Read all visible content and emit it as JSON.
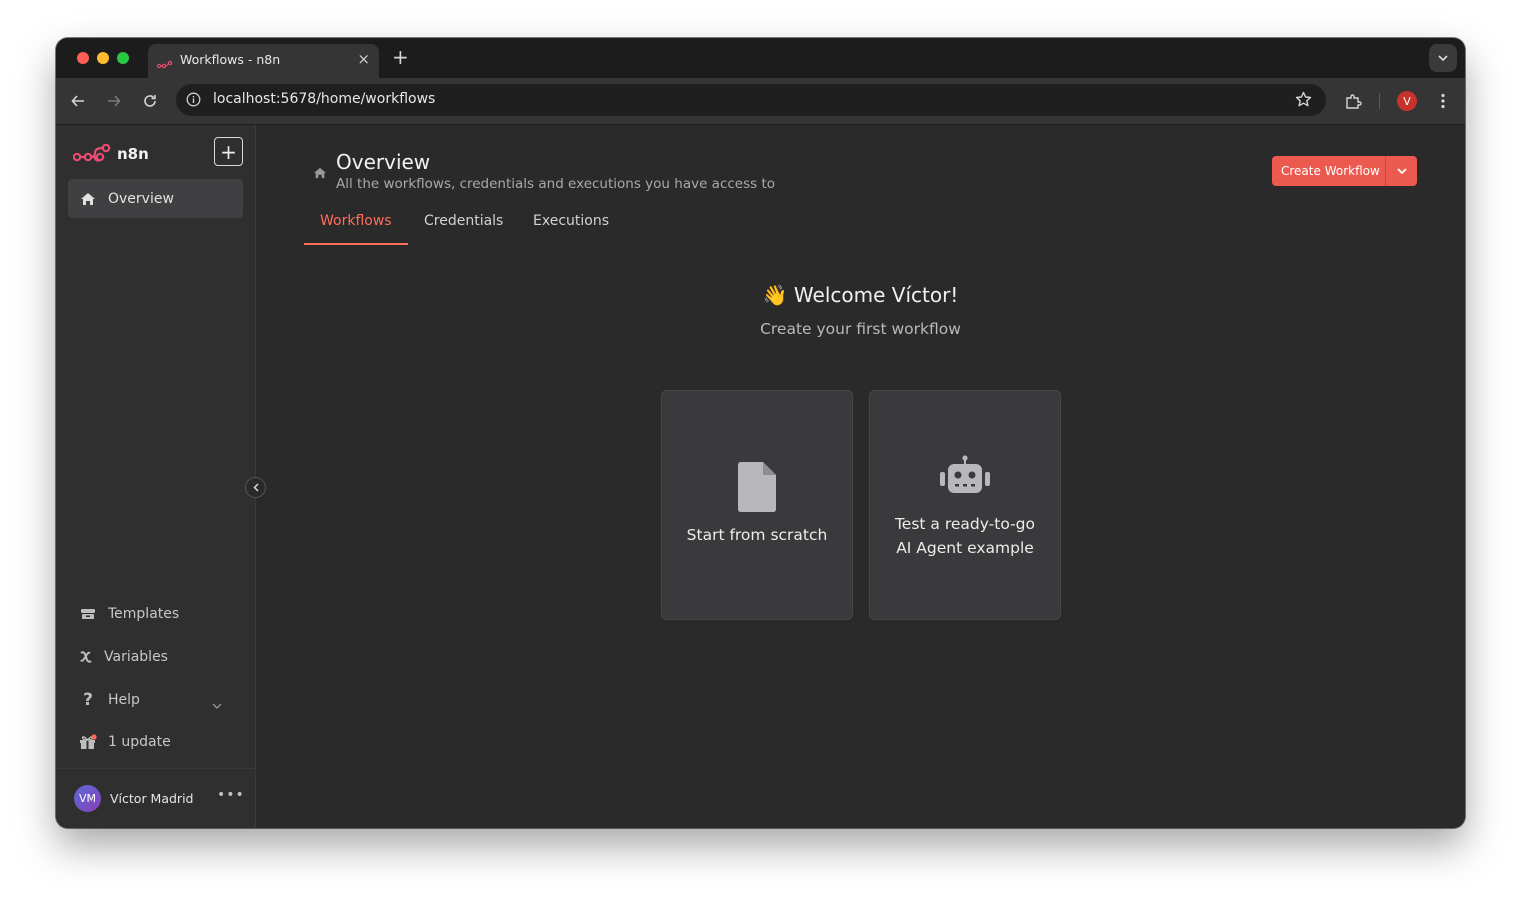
{
  "browser": {
    "tab_title": "Workflows - n8n",
    "tab_close": "×",
    "new_tab": "+",
    "url": "localhost:5678/home/workflows",
    "profile_initial": "V"
  },
  "sidebar": {
    "logo_text": "n8n",
    "add_button": "+",
    "overview_label": "Overview",
    "bottom_items": [
      {
        "label": "Templates",
        "icon": "templates-icon"
      },
      {
        "label": "Variables",
        "icon": "variables-icon"
      },
      {
        "label": "Help",
        "icon": "help-icon"
      },
      {
        "label": "1 update",
        "icon": "gift-icon"
      }
    ],
    "user": {
      "initials": "VM",
      "name": "Víctor Madrid",
      "more": "•••"
    }
  },
  "header": {
    "title": "Overview",
    "subtitle": "All the workflows, credentials and executions you have access to",
    "create_button": "Create Workflow"
  },
  "tabs": [
    {
      "label": "Workflows",
      "active": true
    },
    {
      "label": "Credentials",
      "active": false
    },
    {
      "label": "Executions",
      "active": false
    }
  ],
  "welcome": {
    "title": "👋 Welcome Víctor!",
    "subtitle": "Create your first workflow"
  },
  "cards": [
    {
      "label_line1": "Start from scratch",
      "icon": "file-icon"
    },
    {
      "label_line1": "Test a ready-to-go",
      "label_line2": "AI Agent example",
      "icon": "robot-icon"
    }
  ],
  "colors": {
    "accent": "#ff6d5a",
    "button": "#ec5a4f",
    "background": "#2a2a2b",
    "sidebar": "#2f2f30"
  }
}
